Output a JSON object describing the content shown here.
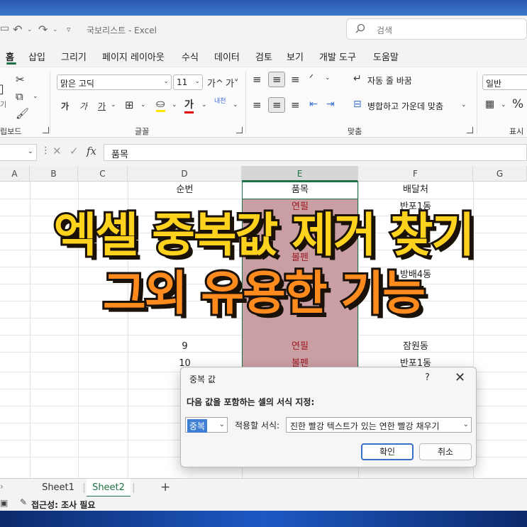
{
  "title_bar": {
    "title": "국보리스트 - Excel",
    "search_placeholder": "검색"
  },
  "menu": [
    "홈",
    "삽입",
    "그리기",
    "페이지 레이아웃",
    "수식",
    "데이터",
    "검토",
    "보기",
    "개발 도구",
    "도움말"
  ],
  "menu_active": "홈",
  "ribbon": {
    "clipboard_label": "립보드",
    "font_name": "맑은 고딕",
    "font_size": "11",
    "font_group_label": "글꼴",
    "wrap_text": "자동 줄 바꿈",
    "merge_center": "병합하고 가운데 맞춤",
    "align_group_label": "맞춤",
    "number_format": "일반",
    "number_group_label": "표시",
    "bold": "가",
    "italic": "가",
    "underline": "가",
    "grow_font": "가^",
    "shrink_font": "가˅",
    "phonetic": "내천",
    "paste_partial": "기",
    "percent": "%"
  },
  "formula_bar": {
    "fx": "fx",
    "content": "품목"
  },
  "columns": [
    "A",
    "B",
    "C",
    "D",
    "E",
    "F",
    "G"
  ],
  "table": {
    "headers": {
      "d": "순번",
      "e": "품목",
      "f": "배달처"
    },
    "partial_rows": [
      {
        "d": "",
        "e": "연필",
        "f": "반포1동"
      }
    ],
    "visible_fragments": {
      "e_row4": "볼펜",
      "f_row5": "방배4동"
    },
    "rows": [
      {
        "d": "9",
        "e": "연필",
        "f": "잠원동"
      },
      {
        "d": "10",
        "e": "볼펜",
        "f": "반포1동"
      }
    ]
  },
  "banner": {
    "line1": "엑셀 중복값 제거 찾기",
    "line2": "그외 유용한 기능"
  },
  "dialog": {
    "title": "중복 값",
    "help": "?",
    "close": "✕",
    "label": "다음 값을 포함하는 셀의 서식 지정:",
    "select1": "중복",
    "mid_label": "적용할 서식:",
    "select2": "진한 빨강 텍스트가 있는 연한 빨강 채우기",
    "ok": "확인",
    "cancel": "취소"
  },
  "sheet_tabs": [
    "Sheet1",
    "Sheet2"
  ],
  "active_sheet": "Sheet2",
  "status_bar": {
    "accessibility": "접근성: 조사 필요"
  },
  "colors": {
    "excel_green": "#1e7145",
    "duplicate_fill": "#c99fa4",
    "duplicate_text": "#9c1b22",
    "banner_yellow": "#ffd21e",
    "banner_orange": "#ff8a1e"
  }
}
